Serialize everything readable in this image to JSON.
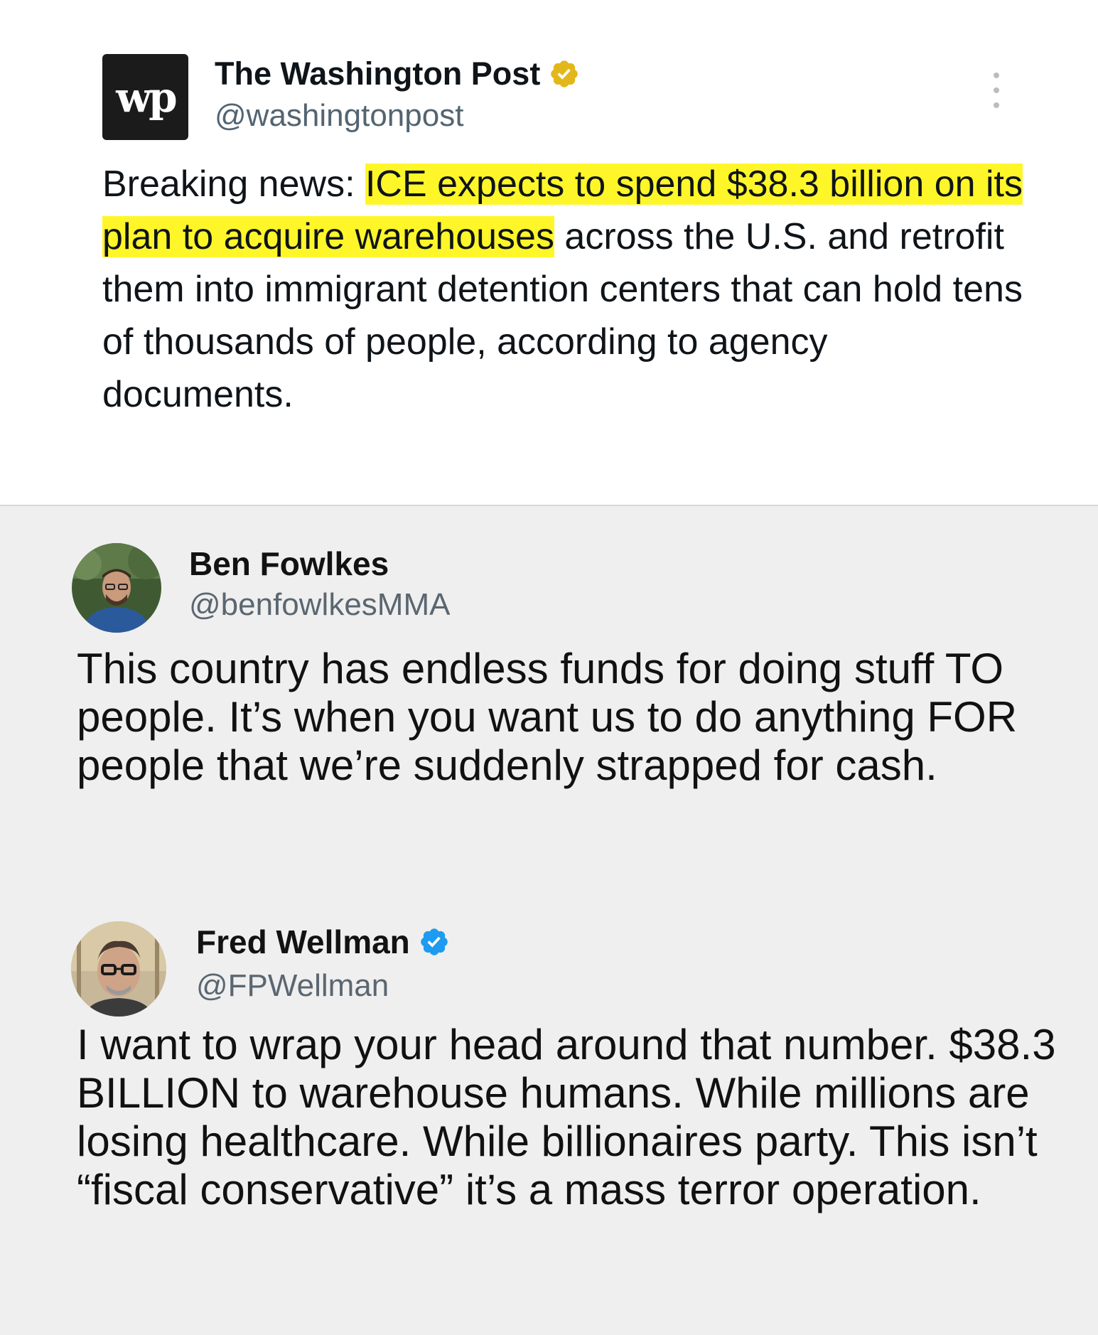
{
  "post": {
    "logo_text": "wp",
    "name": "The Washington Post",
    "handle": "@washingtonpost",
    "text_before": "Breaking news: ",
    "text_highlight": "ICE expects to spend $38.3 billion on its plan to acquire warehouses",
    "text_after": " across the U.S. and retrofit them into immigrant detention centers that can hold tens of thousands of people, according to agency documents.",
    "badge_color": "#e2b719",
    "menu_icon": "more-vertical-icon"
  },
  "replies": [
    {
      "name": "Ben Fowlkes",
      "handle": "@benfowlkesMMA",
      "text": "This country has endless funds for doing stuff TO people. It’s when you want us to do anything FOR people that we’re suddenly strapped for cash."
    },
    {
      "name": "Fred Wellman",
      "handle": "@FPWellman",
      "badge_color": "#1d9bf0",
      "text": "I want to wrap your head around that number. $38.3 BILLION to warehouse humans. While millions are losing healthcare. While billionaires party. This isn’t “fiscal conservative” it’s a mass terror operation."
    }
  ]
}
